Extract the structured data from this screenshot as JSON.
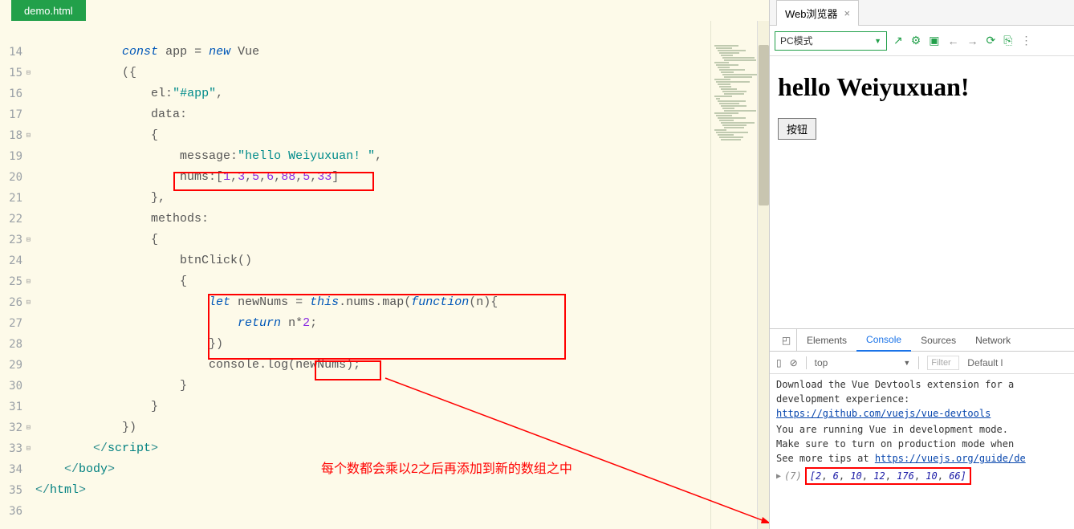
{
  "tab": {
    "filename": "demo.html"
  },
  "gutter": {
    "start": 14,
    "end": 36,
    "fold_lines": [
      15,
      18,
      23,
      25,
      26,
      32,
      33
    ]
  },
  "code": {
    "el_value": "\"#app\"",
    "message_value": "\"hello Weiyuxuan! \"",
    "nums_value": "[1,3,5,6,88,5,33]",
    "map_var": "newNums",
    "map_expr": "this.nums.map(function(n){",
    "return_expr": "return n*2;",
    "console_arg": "newNums"
  },
  "annotation": "每个数都会乘以2之后再添加到新的数组之中",
  "browser": {
    "panel_title": "Web浏览器",
    "mode": "PC模式",
    "heading": "hello Weiyuxuan!",
    "button": "按钮"
  },
  "devtools": {
    "tabs": {
      "elements": "Elements",
      "console": "Console",
      "sources": "Sources",
      "network": "Network"
    },
    "context": "top",
    "filter_placeholder": "Filter",
    "levels": "Default l",
    "msg1": "Download the Vue Devtools extension for a ",
    "msg1b": "development experience:",
    "link1": "https://github.com/vuejs/vue-devtools",
    "msg2": "You are running Vue in development mode.",
    "msg2b": "Make sure to turn on production mode when ",
    "msg2c": "See more tips at ",
    "link2": "https://vuejs.org/guide/de",
    "array_count": "(7)",
    "array_values": [
      2,
      6,
      10,
      12,
      176,
      10,
      66
    ]
  }
}
